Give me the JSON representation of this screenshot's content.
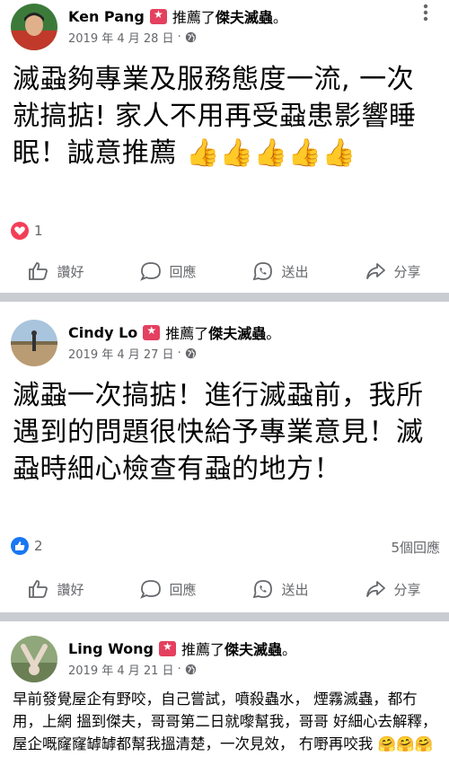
{
  "posts": [
    {
      "author": "Ken Pang",
      "recommend_text": "推薦了",
      "page_name": "傑夫滅蟲",
      "period": "。",
      "date": "2019 年 4 月 28 日",
      "dot": "·",
      "body": "滅蝨夠專業及服務態度一流, 一次就搞掂! 家人不用再受蝨患影響睡眠！誠意推薦 👍👍👍👍👍",
      "reaction_type": "love",
      "reaction_count": "1",
      "comment_count": "",
      "actions": {
        "like": "讚好",
        "comment": "回應",
        "send": "送出",
        "share": "分享"
      }
    },
    {
      "author": "Cindy Lo",
      "recommend_text": "推薦了",
      "page_name": "傑夫滅蟲",
      "period": "。",
      "date": "2019 年 4 月 27 日",
      "dot": "·",
      "body": "滅蝨一次搞掂！進行滅蝨前，我所遇到的問題很快給予專業意見！滅蝨時細心檢查有蝨的地方！",
      "reaction_type": "like",
      "reaction_count": "2",
      "comment_count": "5個回應",
      "actions": {
        "like": "讚好",
        "comment": "回應",
        "send": "送出",
        "share": "分享"
      }
    },
    {
      "author": "Ling Wong",
      "recommend_text": "推薦了",
      "page_name": "傑夫滅蟲",
      "period": "。",
      "date": "2019 年 4 月 21 日",
      "dot": "·",
      "body": "早前發覺屋企有野咬，自己嘗試，噴殺蟲水，  煙霧滅蟲，都冇用，上網 搵到傑夫，哥哥第二日就嚟幫我，哥哥 好細心去解釋，  屋企嘅窿窿罅罅都幫我搵清楚，一次見效，  冇嘢再咬我 🤗🤗🤗"
    }
  ],
  "colors": {
    "divider": "#c9ccd1",
    "badge": "#e4405f",
    "meta": "#65676b",
    "like_blue": "#1877f2",
    "love_red": "#f33e58"
  }
}
